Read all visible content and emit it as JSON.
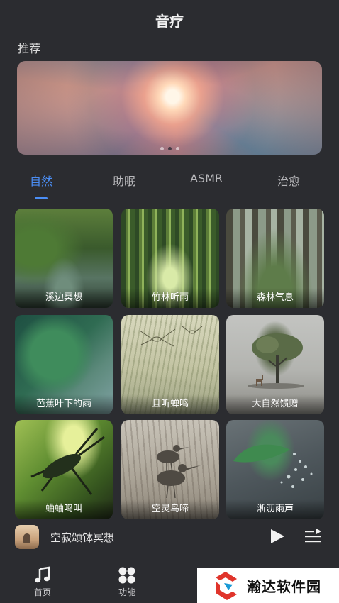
{
  "header": {
    "title": "音疗"
  },
  "recommend": {
    "title": "推荐",
    "banner_dots": 3,
    "active_dot": 2
  },
  "tabs": [
    {
      "label": "自然",
      "active": true
    },
    {
      "label": "助眠",
      "active": false
    },
    {
      "label": "ASMR",
      "active": false
    },
    {
      "label": "治愈",
      "active": false
    }
  ],
  "cards": [
    {
      "label": "溪边冥想"
    },
    {
      "label": "竹林听雨"
    },
    {
      "label": "森林气息"
    },
    {
      "label": "芭蕉叶下的雨"
    },
    {
      "label": "且听蝉鸣"
    },
    {
      "label": "大自然馈赠"
    },
    {
      "label": "蛐蛐鸣叫"
    },
    {
      "label": "空灵鸟啼"
    },
    {
      "label": "淅沥雨声"
    }
  ],
  "player": {
    "track_title": "空寂颂钵冥想",
    "play_icon": "play-icon",
    "playlist_icon": "playlist-icon"
  },
  "bottom_nav": [
    {
      "label": "首页",
      "icon": "music-note-icon"
    },
    {
      "label": "功能",
      "icon": "grid-four-icon"
    }
  ],
  "watermark": {
    "text": "瀚达软件园"
  },
  "colors": {
    "background": "#2b2c30",
    "accent": "#4b8ef5"
  }
}
